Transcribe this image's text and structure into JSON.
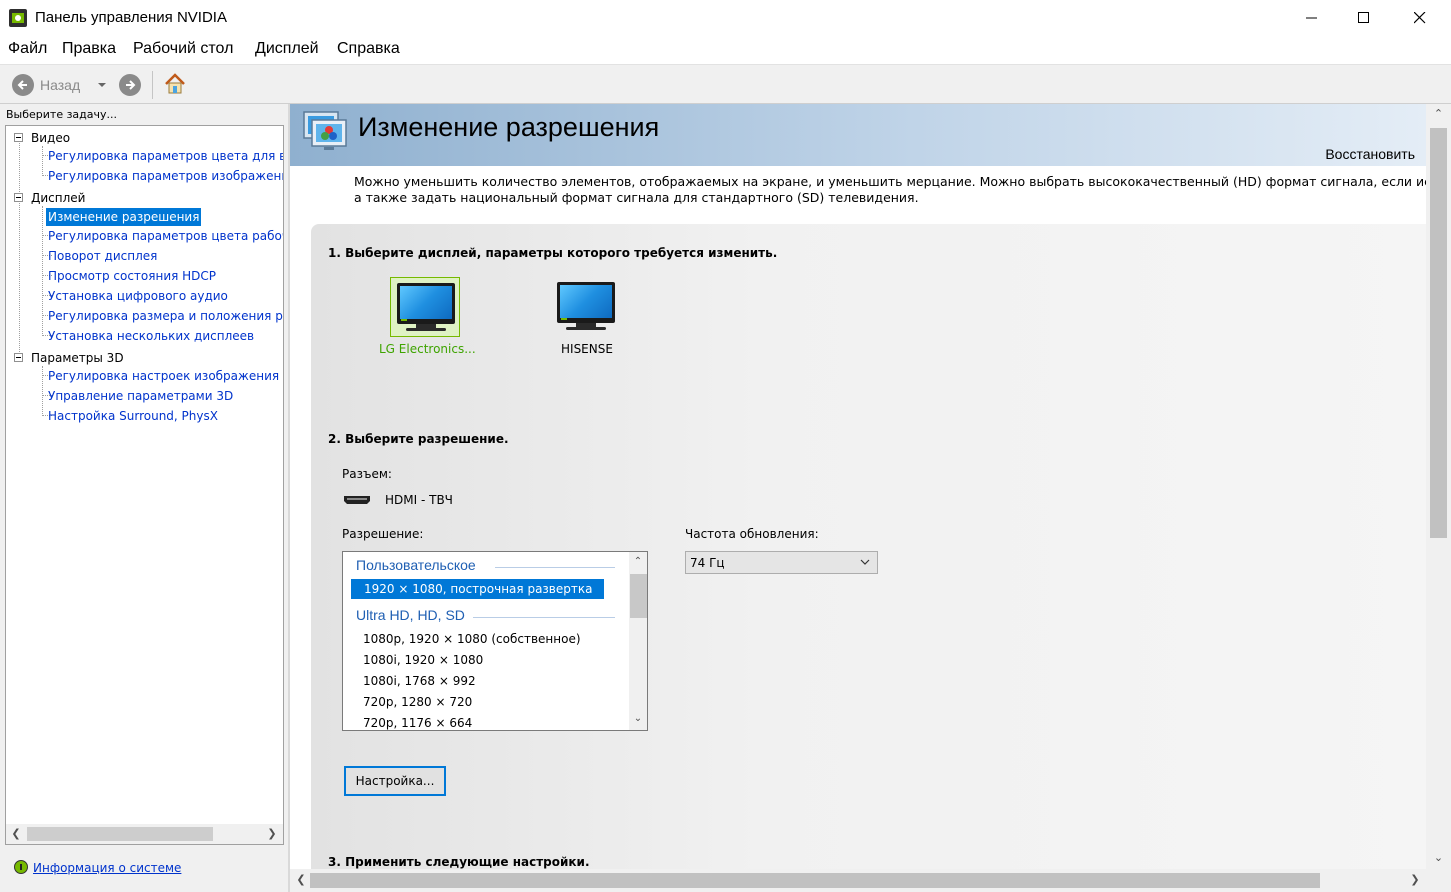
{
  "window": {
    "title": "Панель управления NVIDIA"
  },
  "menu": [
    "Файл",
    "Правка",
    "Рабочий стол",
    "Дисплей",
    "Справка"
  ],
  "toolbar": {
    "back_label": "Назад"
  },
  "sidebar": {
    "task_label": "Выберите задачу...",
    "categories": [
      {
        "label": "Видео",
        "items": [
          "Регулировка параметров цвета для вид",
          "Регулировка параметров изображения д"
        ]
      },
      {
        "label": "Дисплей",
        "items": [
          "Изменение разрешения",
          "Регулировка параметров цвета рабочег",
          "Поворот дисплея",
          "Просмотр состояния HDCP",
          "Установка цифрового аудио",
          "Регулировка размера и положения рабо",
          "Установка нескольких дисплеев"
        ]
      },
      {
        "label": "Параметры 3D",
        "items": [
          "Регулировка настроек изображения с п",
          "Управление параметрами 3D",
          "Настройка Surround, PhysX"
        ]
      }
    ],
    "selected_item": "Изменение разрешения",
    "system_info_link": "Информация о системе"
  },
  "main": {
    "page_title": "Изменение разрешения",
    "restore_label": "Восстановить",
    "description_line1": "Можно уменьшить количество элементов, отображаемых на экране, и уменьшить мерцание. Можно выбрать высококачественный (HD) формат сигнала, если испол",
    "description_line2": "а также задать национальный формат сигнала для стандартного (SD) телевидения.",
    "step1_title": "1. Выберите дисплей, параметры которого требуется изменить.",
    "displays": [
      {
        "name": "LG Electronics...",
        "selected": true
      },
      {
        "name": "HISENSE",
        "selected": false
      }
    ],
    "step2_title": "2. Выберите разрешение.",
    "connector_label": "Разъем:",
    "connector_value": "HDMI - ТВЧ",
    "resolution_label": "Разрешение:",
    "resolution_groups": [
      {
        "name": "Пользовательское",
        "items": [
          "1920 × 1080, построчная развертка"
        ]
      },
      {
        "name": "Ultra HD, HD, SD",
        "items": [
          "1080p, 1920 × 1080 (собственное)",
          "1080i, 1920 × 1080",
          "1080i, 1768 × 992",
          "720p, 1280 × 720",
          "720p, 1176 × 664"
        ]
      }
    ],
    "selected_resolution": "1920 × 1080, построчная развертка",
    "refresh_label": "Частота обновления:",
    "refresh_value": "74 Гц",
    "customize_button": "Настройка...",
    "step3_title": "3. Применить следующие настройки."
  },
  "colors": {
    "nvidia_green": "#76b900",
    "selection_blue": "#0078d7",
    "link_blue": "#0033cc",
    "header_blue": "#8fb0cf",
    "group_blue": "#1f5fb3"
  }
}
